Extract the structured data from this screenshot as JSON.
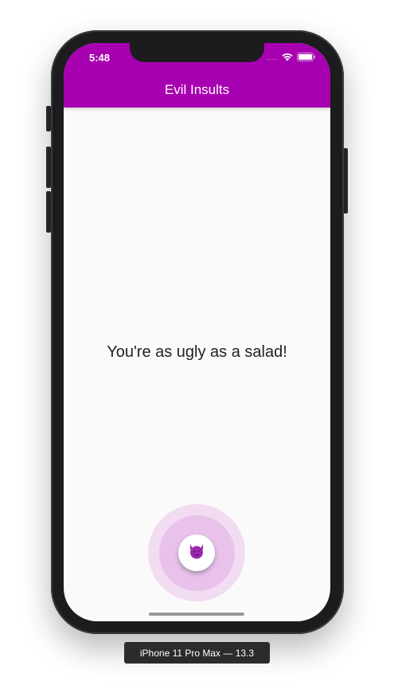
{
  "status_bar": {
    "time": "5:48",
    "signal": "....",
    "icons": [
      "wifi-icon",
      "battery-icon"
    ]
  },
  "app_bar": {
    "title": "Evil Insults",
    "color": "#a700b1"
  },
  "content": {
    "insult_text": "You're as ugly as a salad!"
  },
  "fab": {
    "icon": "smiling-devil-icon",
    "ripple_colors": [
      "#f2dcf2",
      "#e8c2ea"
    ]
  },
  "simulator": {
    "device_label": "iPhone 11 Pro Max — 13.3"
  }
}
